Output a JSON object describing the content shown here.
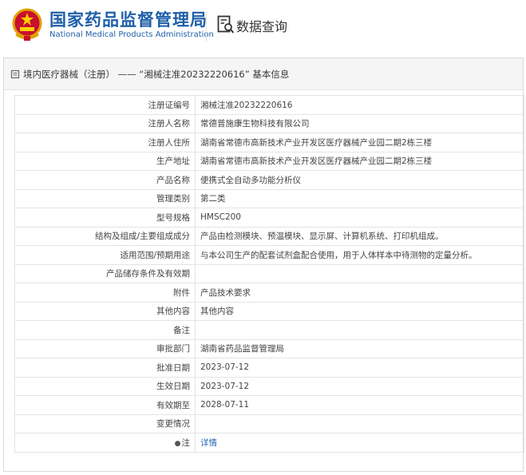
{
  "header": {
    "org_name_cn": "国家药品监督管理局",
    "org_name_en": "National Medical Products Administration",
    "query_label": "数据查询"
  },
  "panel": {
    "title": "境内医疗器械（注册） —— “湘械注准20232220616” 基本信息"
  },
  "rows": [
    {
      "label": "注册证编号",
      "value": "湘械注准20232220616"
    },
    {
      "label": "注册人名称",
      "value": "常德普施康生物科技有限公司"
    },
    {
      "label": "注册人住所",
      "value": "湖南省常德市高新技术产业开发区医疗器械产业园二期2栋三楼"
    },
    {
      "label": "生产地址",
      "value": "湖南省常德市高新技术产业开发区医疗器械产业园二期2栋三楼"
    },
    {
      "label": "产品名称",
      "value": "便携式全自动多功能分析仪"
    },
    {
      "label": "管理类别",
      "value": "第二类"
    },
    {
      "label": "型号规格",
      "value": "HMSC200"
    },
    {
      "label": "结构及组成/主要组成成分",
      "value": "产品由检测模块、预温模块、显示屏、计算机系统、打印机组成。"
    },
    {
      "label": "适用范围/预期用途",
      "value": "与本公司生产的配套试剂盒配合使用，用于人体样本中待测物的定量分析。"
    },
    {
      "label": "产品储存条件及有效期",
      "value": ""
    },
    {
      "label": "附件",
      "value": "产品技术要求"
    },
    {
      "label": "其他内容",
      "value": "其他内容"
    },
    {
      "label": "备注",
      "value": ""
    },
    {
      "label": "审批部门",
      "value": "湖南省药品监督管理局"
    },
    {
      "label": "批准日期",
      "value": "2023-07-12"
    },
    {
      "label": "生效日期",
      "value": "2023-07-12"
    },
    {
      "label": "有效期至",
      "value": "2028-07-11"
    },
    {
      "label": "变更情况",
      "value": ""
    }
  ],
  "note_row": {
    "label": "注",
    "link": "详情"
  },
  "colors": {
    "brand_blue": "#1f5fa8",
    "link_blue": "#2b63b6"
  },
  "icons": {
    "emblem": "national-emblem-icon",
    "query": "document-search-icon",
    "title": "document-icon",
    "note": "pin-icon"
  }
}
